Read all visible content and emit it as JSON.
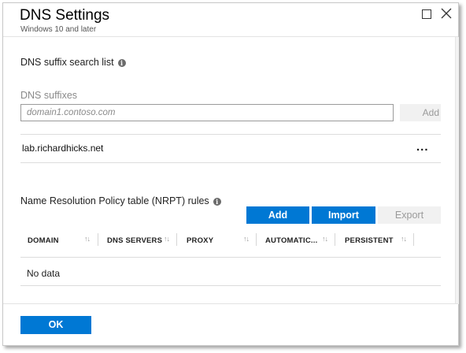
{
  "window": {
    "title": "DNS Settings",
    "subtitle": "Windows 10 and later"
  },
  "suffix_section": {
    "heading": "DNS suffix search list",
    "field_label": "DNS suffixes",
    "input_value": "",
    "input_placeholder": "domain1.contoso.com",
    "add_label": "Add",
    "items": [
      {
        "label": "lab.richardhicks.net",
        "more": "..."
      }
    ]
  },
  "nrpt_section": {
    "heading": "Name Resolution Policy table (NRPT) rules",
    "buttons": {
      "add": "Add",
      "import": "Import",
      "export": "Export"
    },
    "columns": [
      "DOMAIN",
      "DNS SERVERS",
      "PROXY",
      "AUTOMATIC...",
      "PERSISTENT"
    ],
    "empty_text": "No data"
  },
  "footer": {
    "ok_label": "OK"
  },
  "colors": {
    "accent": "#0078d4",
    "disabled_bg": "#f1f1f1",
    "disabled_text": "#9a9a9a"
  },
  "icons": {
    "info": "info-icon",
    "sort": "sort-arrows-icon",
    "maximize": "maximize-icon",
    "close": "close-icon"
  }
}
